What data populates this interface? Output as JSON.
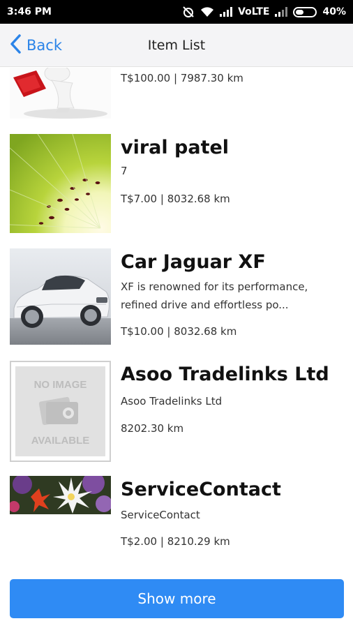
{
  "status_bar": {
    "time": "3:46 PM",
    "network": "VoLTE",
    "battery": "40%",
    "battery_level": 0.4
  },
  "navbar": {
    "back_label": "Back",
    "title": "Item List"
  },
  "items": [
    {
      "title": "",
      "description": "",
      "meta": "T$100.00 | 7987.30 km",
      "image": "person-with-red-bag"
    },
    {
      "title": "viral patel",
      "description": "7",
      "meta": "T$7.00 | 8032.68 km",
      "image": "kiwi-slice"
    },
    {
      "title": "Car Jaguar XF",
      "description": "XF is renowned for its performance, refined drive and effortless po...",
      "meta": "T$10.00 | 8032.68 km",
      "image": "white-jaguar-car"
    },
    {
      "title": "Asoo Tradelinks Ltd",
      "description": "Asoo Tradelinks Ltd",
      "meta": "8202.30 km",
      "image": "no-image-placeholder",
      "placeholder_line1": "NO IMAGE",
      "placeholder_line2": "AVAILABLE"
    },
    {
      "title": "ServiceContact",
      "description": "ServiceContact",
      "meta": "T$2.00 | 8210.29 km",
      "image": "flowers"
    }
  ],
  "show_more_label": "Show more",
  "colors": {
    "accent": "#2f8bf4",
    "nav_link": "#2b84e8",
    "status_bar": "#000000"
  }
}
